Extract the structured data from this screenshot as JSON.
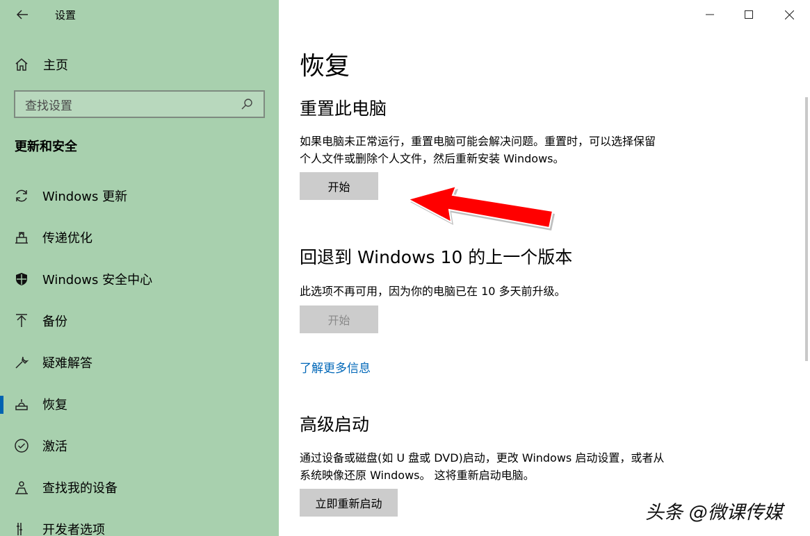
{
  "sidebar": {
    "app_title": "设置",
    "home_label": "主页",
    "search_placeholder": "查找设置",
    "section_heading": "更新和安全",
    "items": [
      {
        "label": "Windows 更新",
        "icon": "sync-icon"
      },
      {
        "label": "传递优化",
        "icon": "delivery-optimization-icon"
      },
      {
        "label": "Windows 安全中心",
        "icon": "shield-icon"
      },
      {
        "label": "备份",
        "icon": "backup-arrow-up-icon"
      },
      {
        "label": "疑难解答",
        "icon": "wrench-icon"
      },
      {
        "label": "恢复",
        "icon": "recovery-icon",
        "active": true
      },
      {
        "label": "激活",
        "icon": "check-circle-icon"
      },
      {
        "label": "查找我的设备",
        "icon": "find-device-person-icon"
      },
      {
        "label": "开发者选项",
        "icon": "developer-tools-icon"
      }
    ]
  },
  "main": {
    "title": "恢复",
    "reset": {
      "heading": "重置此电脑",
      "desc_line1": "如果电脑未正常运行，重置电脑可能会解决问题。重置时，可以选择保留",
      "desc_line2": "个人文件或删除个人文件，然后重新安装 Windows。",
      "button": "开始"
    },
    "rollback": {
      "heading": "回退到 Windows 10 的上一个版本",
      "desc": "此选项不再可用，因为你的电脑已在 10 多天前升级。",
      "button": "开始"
    },
    "learn_more": "了解更多信息",
    "advanced": {
      "heading": "高级启动",
      "desc_line1": "通过设备或磁盘(如 U 盘或 DVD)启动，更改 Windows 启动设置，或者从",
      "desc_line2": "系统映像还原 Windows。 这将重新启动电脑。",
      "button": "立即重新启动"
    }
  },
  "overlay": {
    "watermark": "头条 @微课传媒",
    "arrow_color": "#ff0000"
  },
  "colors": {
    "sidebar_bg": "#a8d0ae",
    "accent": "#0063b1",
    "link": "#0067b8",
    "button_bg": "#cccccc"
  }
}
